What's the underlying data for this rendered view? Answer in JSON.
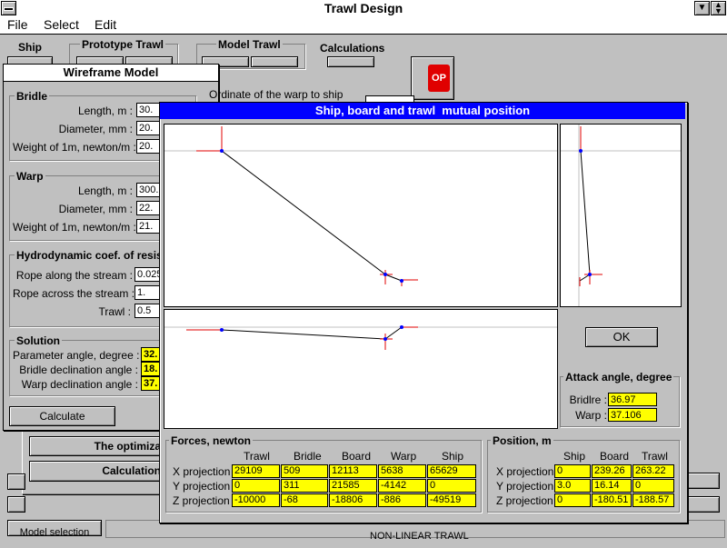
{
  "app": {
    "title": "Trawl Design"
  },
  "menu": [
    "File",
    "Select",
    "Edit"
  ],
  "toolbar": {
    "ship_label": "Ship",
    "prototype_label": "Prototype Trawl",
    "model_label": "Model Trawl",
    "calc_label": "Calculations",
    "stop_label": "OP"
  },
  "background": {
    "optimiz_button": "The optimiza",
    "calcul_button": "Calculation",
    "model_selection_button": "Model selection"
  },
  "wireframe": {
    "title": "Wireframe Model",
    "ordinate_label": "Ordinate of the warp to ship",
    "bridle": {
      "title": "Bridle",
      "length_label": "Length, m :",
      "length_value": "30.",
      "diameter_label": "Diameter, mm :",
      "diameter_value": "20.",
      "weight_label": "Weight of 1m, newton/m :",
      "weight_value": "20."
    },
    "warp": {
      "title": "Warp",
      "length_label": "Length, m :",
      "length_value": "300.",
      "diameter_label": "Diameter, mm :",
      "diameter_value": "22.",
      "weight_label": "Weight of 1m, newton/m :",
      "weight_value": "21."
    },
    "hydro": {
      "title": "Hydrodynamic coef. of resis",
      "along_label": "Rope along the stream :",
      "along_value": "0.025",
      "across_label": "Rope across the stream :",
      "across_value": "1.",
      "trawl_label": "Trawl :",
      "trawl_value": "0.5"
    },
    "solution": {
      "title": "Solution",
      "param_label": "Parameter angle, degree :",
      "param_value": "32.",
      "bridle_decl_label": "Bridle declination angle :",
      "bridle_decl_value": "18.",
      "warp_decl_label": "Warp declination angle :",
      "warp_decl_value": "37."
    },
    "calculate_button": "Calculate"
  },
  "dialog": {
    "title": "Ship, board and trawl  mutual position",
    "ok_button": "OK",
    "attack": {
      "title": "Attack angle, degree",
      "bridle_label": "Bridlre :",
      "bridle_value": "36.97",
      "warp_label": "Warp :",
      "warp_value": "37.106"
    },
    "forces": {
      "title": "Forces, newton",
      "columns": [
        "Trawl",
        "Bridle",
        "Board",
        "Warp",
        "Ship"
      ],
      "rows": [
        {
          "label": "X projection",
          "values": [
            "29109",
            "509",
            "12113",
            "5638",
            "65629"
          ]
        },
        {
          "label": "Y projection",
          "values": [
            "0",
            "311",
            "21585",
            "-4142",
            "0"
          ]
        },
        {
          "label": "Z projection",
          "values": [
            "-10000",
            "-68",
            "-18806",
            "-886",
            "-49519"
          ]
        }
      ]
    },
    "position": {
      "title": "Position, m",
      "columns": [
        "Ship",
        "Board",
        "Trawl"
      ],
      "rows": [
        {
          "label": "X projection",
          "values": [
            "0",
            "239.26",
            "263.22"
          ]
        },
        {
          "label": "Y projection",
          "values": [
            "3.0",
            "16.14",
            "0"
          ]
        },
        {
          "label": "Z projection",
          "values": [
            "0",
            "-180.51",
            "-188.57"
          ]
        }
      ]
    }
  },
  "bottom": {
    "status_text": "NON-LINEAR TRAWL"
  }
}
